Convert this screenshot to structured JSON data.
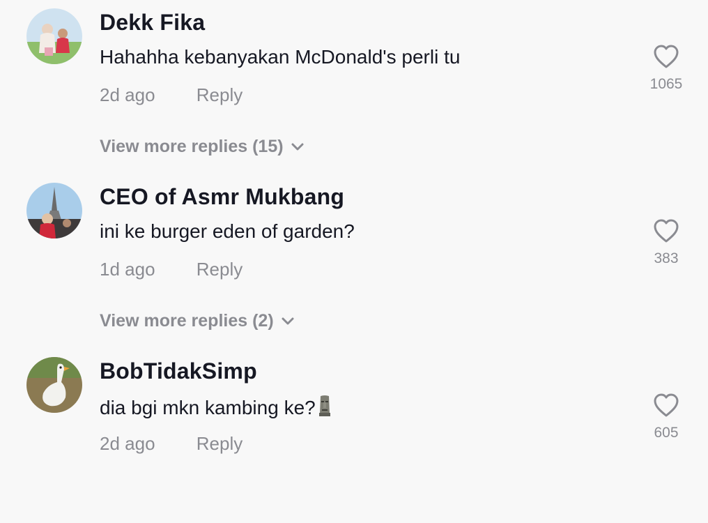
{
  "comments": [
    {
      "username": "Dekk Fika",
      "text": "Hahahha kebanyakan McDonald's perli tu",
      "time": "2d ago",
      "reply_label": "Reply",
      "likes": "1065",
      "view_more": "View more replies (15)",
      "avatar_icon": "user-avatar"
    },
    {
      "username": "CEO of Asmr Mukbang",
      "text": "ini ke burger eden of garden?",
      "time": "1d ago",
      "reply_label": "Reply",
      "likes": "383",
      "view_more": "View more replies (2)",
      "avatar_icon": "user-avatar"
    },
    {
      "username": "BobTidakSimp",
      "text": "dia bgi mkn kambing ke?",
      "text_emoji": "moai-emoji",
      "time": "2d ago",
      "reply_label": "Reply",
      "likes": "605",
      "avatar_icon": "user-avatar"
    }
  ]
}
